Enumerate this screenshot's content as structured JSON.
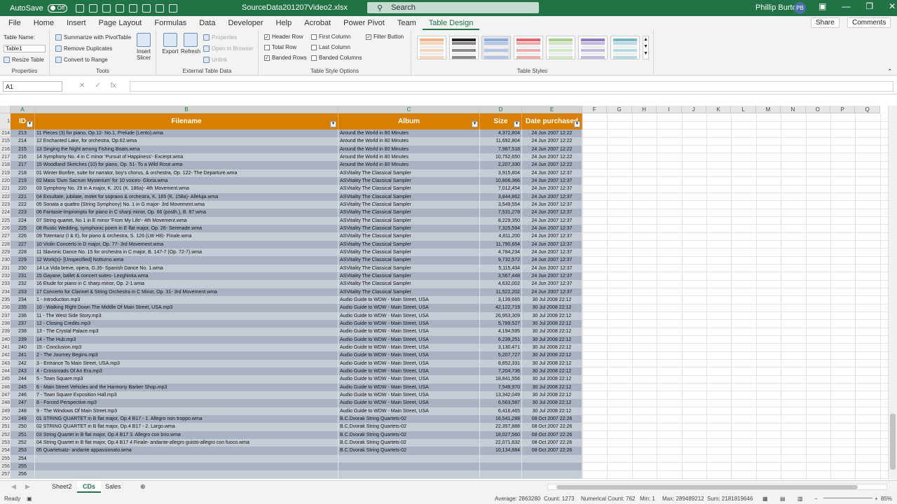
{
  "titlebar": {
    "autosave_label": "AutoSave",
    "autosave_state": "Off",
    "file_title": "SourceData201207Video2.xlsx",
    "search_placeholder": "Search",
    "user_name": "Phillip Burton",
    "user_initials": "PB"
  },
  "menu_tabs": [
    "File",
    "Home",
    "Insert",
    "Page Layout",
    "Formulas",
    "Data",
    "Developer",
    "Help",
    "Acrobat",
    "Power Pivot",
    "Team",
    "Table Design"
  ],
  "share_label": "Share",
  "comments_label": "Comments",
  "ribbon": {
    "properties": {
      "table_name_label": "Table Name:",
      "table_name_value": "Table1",
      "resize_label": "Resize Table",
      "group": "Properties"
    },
    "tools": {
      "summarize": "Summarize with PivotTable",
      "remove_duplicates": "Remove Duplicates",
      "convert": "Convert to Range",
      "insert_slicer": "Insert Slicer",
      "group": "Tools"
    },
    "external": {
      "export": "Export",
      "refresh": "Refresh",
      "properties": "Properties",
      "open_browser": "Open in Browser",
      "unlink": "Unlink",
      "group": "External Table Data"
    },
    "style_options": {
      "header_row": "Header Row",
      "total_row": "Total Row",
      "banded_rows": "Banded Rows",
      "first_column": "First Column",
      "last_column": "Last Column",
      "banded_columns": "Banded Columns",
      "filter_button": "Filter Button",
      "group": "Table Style Options"
    },
    "table_styles": {
      "group": "Table Styles"
    }
  },
  "formula_bar": {
    "name_box": "A1",
    "fx": "fx",
    "formula": ""
  },
  "columns": [
    "A",
    "B",
    "C",
    "D",
    "E",
    "F",
    "G",
    "H",
    "I",
    "J",
    "K",
    "L",
    "M",
    "N",
    "O",
    "P",
    "Q"
  ],
  "table": {
    "headers": [
      "ID",
      "Filename",
      "Album",
      "Size",
      "Date purchased"
    ],
    "header_row_number": "1",
    "rows": [
      [
        "214",
        "213",
        "11 Pieces (3) for piano, Op.12- No.1, Prelude (Lento).wma",
        "Around the World in 80 Minutes",
        "4,372,804",
        "24 Jun 2007 12:22"
      ],
      [
        "215",
        "214",
        "12 Enchanted Lake, for orchestra, Op.62.wma",
        "Around the World in 80 Minutes",
        "11,692,804",
        "24 Jun 2007 12:22"
      ],
      [
        "216",
        "215",
        "13 Singing the Night among Fishing Boats.wma",
        "Around the World in 80 Minutes",
        "7,987,518",
        "24 Jun 2007 12:22"
      ],
      [
        "217",
        "216",
        "14 Symphony No. 4 in C minor 'Pursuit of Happiness'- Excerpt.wma",
        "Around the World in 80 Minutes",
        "10,752,650",
        "24 Jun 2007 12:22"
      ],
      [
        "218",
        "217",
        "15 Woodland Sketches (10) for piano, Op. 51- To a Wild Rose.wma",
        "Around the World in 80 Minutes",
        "2,207,330",
        "24 Jun 2007 12:22"
      ],
      [
        "219",
        "218",
        "01 Winter Bonfire, suite for narrator, boy's chorus, & orchestra, Op. 122- The Departure.wma",
        "ASVitality  The Classical Sampler",
        "3,915,804",
        "24 Jun 2007 12:37"
      ],
      [
        "220",
        "219",
        "02 Mass 'Dum Sacrum Mysterium' for 10 voices- Gloria.wma",
        "ASVitality  The Classical Sampler",
        "10,806,366",
        "24 Jun 2007 12:37"
      ],
      [
        "221",
        "220",
        "03 Symphony No. 29 in A major, K. 201 (K. 186a)- 4th Movement.wma",
        "ASVitality  The Classical Sampler",
        "7,012,454",
        "24 Jun 2007 12:37"
      ],
      [
        "222",
        "221",
        "04 Exsultate, jubilate, motet for soprano & orchestra, K. 165 (K. 158a)- Alleluja.wma",
        "ASVitality  The Classical Sampler",
        "3,844,862",
        "24 Jun 2007 12:37"
      ],
      [
        "223",
        "222",
        "05 Sonata a quattro (String Symphony) No. 1 in G major- 3rd Movement.wma",
        "ASVitality  The Classical Sampler",
        "3,549,554",
        "24 Jun 2007 12:37"
      ],
      [
        "224",
        "223",
        "06 Fantasie-Impromptu for piano in C sharp minor, Op. 66 (posth.), B. 87.wma",
        "ASVitality  The Classical Sampler",
        "7,531,278",
        "24 Jun 2007 12:37"
      ],
      [
        "225",
        "224",
        "07 String quartet, No 1 in E minor 'From My Life'- 4th Movement.wma",
        "ASVitality  The Classical Sampler",
        "8,229,350",
        "24 Jun 2007 12:37"
      ],
      [
        "226",
        "225",
        "08 Rustic Wedding, symphonic poem in E flat major, Op. 26- Serenade.wma",
        "ASVitality  The Classical Sampler",
        "7,325,594",
        "24 Jun 2007 12:37"
      ],
      [
        "227",
        "226",
        "09 Totentanz (I & II), for piano & orchestra, S. 126 (LW H8)- Finale.wma",
        "ASVitality  The Classical Sampler",
        "4,811,200",
        "24 Jun 2007 12:37"
      ],
      [
        "228",
        "227",
        "10 Violin Concerto in D major, Op. 77- 3rd Movement.wma",
        "ASVitality  The Classical Sampler",
        "11,790,654",
        "24 Jun 2007 12:37"
      ],
      [
        "229",
        "228",
        "11 Slavonic Dance No. 15 for orchestra in C major, B. 147-7 (Op. 72-7).wma",
        "ASVitality  The Classical Sampler",
        "4,784,234",
        "24 Jun 2007 12:37"
      ],
      [
        "230",
        "229",
        "12 Work(s)- [Unspecified] Notturno.wma",
        "ASVitality  The Classical Sampler",
        "9,732,572",
        "24 Jun 2007 12:37"
      ],
      [
        "231",
        "230",
        "14 La Vida breve, opera, G.35- Spanish Dance No. 1.wma",
        "ASVitality  The Classical Sampler",
        "5,115,434",
        "24 Jun 2007 12:37"
      ],
      [
        "232",
        "231",
        "15 Gayane, ballet & concert suites- Lezghinka.wma",
        "ASVitality  The Classical Sampler",
        "3,567,448",
        "24 Jun 2007 12:37"
      ],
      [
        "233",
        "232",
        "16 Etude for piano in C sharp minor, Op. 2-1.wma",
        "ASVitality  The Classical Sampler",
        "4,632,002",
        "24 Jun 2007 12:37"
      ],
      [
        "234",
        "233",
        "17 Concerto for Clarinet & String Orchestra in C Minor, Op. 31- 3rd Movement.wma",
        "ASVitality  The Classical Sampler",
        "11,522,202",
        "24 Jun 2007 12:37"
      ],
      [
        "235",
        "234",
        "1 - Introduction.mp3",
        "Audio Guide to WDW - Main Street, USA",
        "3,139,665",
        "30 Jul 2008 22:12"
      ],
      [
        "236",
        "235",
        "10 - Walking Right Down The Middle Of Main Street, USA.mp3",
        "Audio Guide to WDW - Main Street, USA",
        "42,122,719",
        "30 Jul 2008 22:12"
      ],
      [
        "237",
        "236",
        "11 - The West Side Story.mp3",
        "Audio Guide to WDW - Main Street, USA",
        "26,953,309",
        "30 Jul 2008 22:12"
      ],
      [
        "238",
        "237",
        "12 - Closing Credits.mp3",
        "Audio Guide to WDW - Main Street, USA",
        "5,789,527",
        "30 Jul 2008 22:12"
      ],
      [
        "239",
        "238",
        "13 - The Crystal Palace.mp3",
        "Audio Guide to WDW - Main Street, USA",
        "4,194,595",
        "30 Jul 2008 22:12"
      ],
      [
        "240",
        "239",
        "14 - The Hub.mp3",
        "Audio Guide to WDW - Main Street, USA",
        "6,239,251",
        "30 Jul 2008 22:12"
      ],
      [
        "241",
        "240",
        "15 - Conclusion.mp3",
        "Audio Guide to WDW - Main Street, USA",
        "3,130,471",
        "30 Jul 2008 22:12"
      ],
      [
        "242",
        "241",
        "2 - The Journey Begins.mp3",
        "Audio Guide to WDW - Main Street, USA",
        "5,207,727",
        "30 Jul 2008 22:12"
      ],
      [
        "243",
        "242",
        "3 - Entrance To Main Street, USA.mp3",
        "Audio Guide to WDW - Main Street, USA",
        "8,852,331",
        "30 Jul 2008 22:12"
      ],
      [
        "244",
        "243",
        "4 - Crossroads Of An Era.mp3",
        "Audio Guide to WDW - Main Street, USA",
        "7,204,736",
        "30 Jul 2008 22:12"
      ],
      [
        "245",
        "244",
        "5 - Town Square.mp3",
        "Audio Guide to WDW - Main Street, USA",
        "18,841,556",
        "30 Jul 2008 22:12"
      ],
      [
        "246",
        "245",
        "6 - Main Street Vehicles and the Harmony Barber Shop.mp3",
        "Audio Guide to WDW - Main Street, USA",
        "7,549,970",
        "30 Jul 2008 22:12"
      ],
      [
        "247",
        "246",
        "7 - Town Square Exposition Hall.mp3",
        "Audio Guide to WDW - Main Street, USA",
        "13,342,049",
        "30 Jul 2008 22:12"
      ],
      [
        "248",
        "247",
        "8 - Forced Perspective.mp3",
        "Audio Guide to WDW - Main Street, USA",
        "6,563,587",
        "30 Jul 2008 22:12"
      ],
      [
        "249",
        "248",
        "9 - The Windows Of Main Street.mp3",
        "Audio Guide to WDW - Main Street, USA",
        "6,416,465",
        "30 Jul 2008 22:12"
      ],
      [
        "250",
        "249",
        "01 STRING QUARTET in B flat major, Op.4 B17 - 1. Allegro non troppo.wma",
        "B.C.Dvorak String Quartets-02",
        "16,541,288",
        "08 Oct 2007 22:26"
      ],
      [
        "251",
        "250",
        "02 STRING QUARTET in B flat major, Op.4 B17 - 2. Largo.wma",
        "B.C.Dvorak String Quartets-02",
        "22,357,888",
        "08 Oct 2007 22:26"
      ],
      [
        "252",
        "251",
        "03 String Quartet in B flat major, Op.4 B17 3. Allegro con brio.wma",
        "B.C.Dvorak String Quartets-02",
        "18,027,560",
        "08 Oct 2007 22:26"
      ],
      [
        "253",
        "252",
        "04 String Quartet in B flat major, Op.4 B17 4 Finale- andante-allegro guisto-allegro con fuoco.wma",
        "B.C.Dvorak String Quartets-02",
        "22,071,632",
        "08 Oct 2007 22:26"
      ],
      [
        "254",
        "253",
        "05 Quartetsatz- andante appassionato.wma",
        "B.C.Dvorak String Quartets-02",
        "10,134,884",
        "08 Oct 2007 22:26"
      ],
      [
        "255",
        "254",
        "",
        "",
        "",
        ""
      ],
      [
        "256",
        "255",
        "",
        "",
        "",
        ""
      ],
      [
        "257",
        "256",
        "",
        "",
        "",
        ""
      ]
    ]
  },
  "sheet_tabs": [
    "Sheet2",
    "CDs",
    "Sales"
  ],
  "active_sheet": "CDs",
  "status": {
    "ready": "Ready",
    "average": "Average: 2863280",
    "count": "Count: 1273",
    "numerical_count": "Numerical Count: 762",
    "min": "Min: 1",
    "max": "Max: 289489212",
    "sum": "Sum: 2181819646",
    "zoom": "85%"
  }
}
